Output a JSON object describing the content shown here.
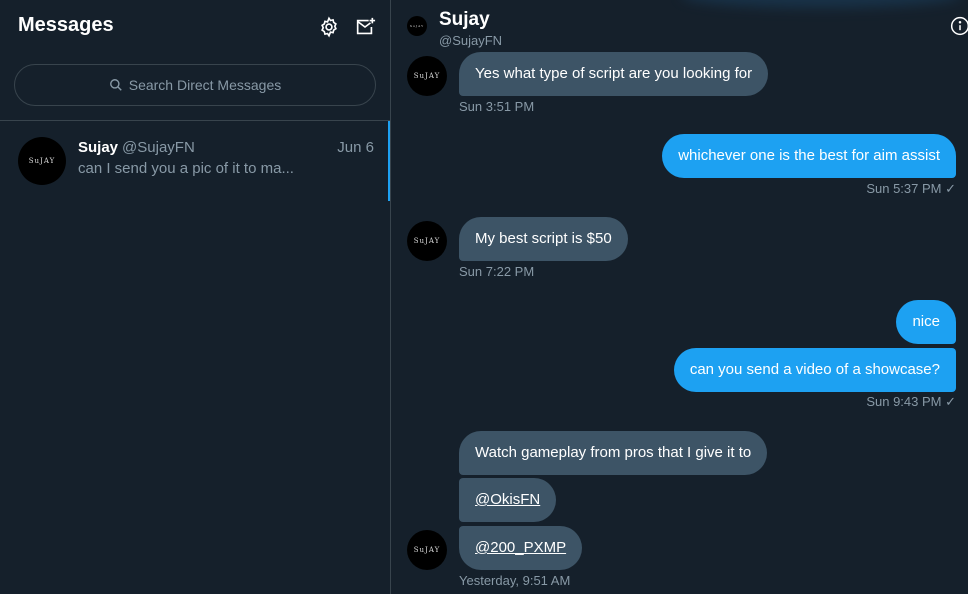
{
  "sidebar": {
    "title": "Messages",
    "settings_icon": "gear-icon",
    "new_message_icon": "new-message-icon",
    "search": {
      "placeholder": "Search Direct Messages"
    },
    "conversations": [
      {
        "name": "Sujay",
        "handle": "@SujayFN",
        "date": "Jun 6",
        "preview": "can I send you a pic of it to ma...",
        "avatar_text": "SuJAY"
      }
    ]
  },
  "chat": {
    "name": "Sujay",
    "handle": "@SujayFN",
    "avatar_text": "SuJAY",
    "info_icon": "info-icon",
    "messages": [
      {
        "dir": "in",
        "text": "Yes what type of script are you looking for",
        "time": "Sun 3:51 PM"
      },
      {
        "dir": "out",
        "text": "whichever one is the best for aim assist",
        "time": "Sun 5:37 PM ✓"
      },
      {
        "dir": "in",
        "text": "My best script is $50",
        "time": "Sun 7:22 PM"
      },
      {
        "dir": "out",
        "text": "nice"
      },
      {
        "dir": "out",
        "text": "can you send a video of a showcase?",
        "time": "Sun 9:43 PM ✓"
      },
      {
        "dir": "in",
        "text": "Watch gameplay from pros that I give it to"
      },
      {
        "dir": "in",
        "text": "@OkisFN"
      },
      {
        "dir": "in",
        "text": "@200_PXMP",
        "time": "Yesterday, 9:51 AM"
      }
    ]
  },
  "colors": {
    "background": "#15202b",
    "incoming_bubble": "#3d5466",
    "outgoing_bubble": "#1da1f2",
    "muted_text": "#8899a6",
    "border": "#38444d"
  }
}
